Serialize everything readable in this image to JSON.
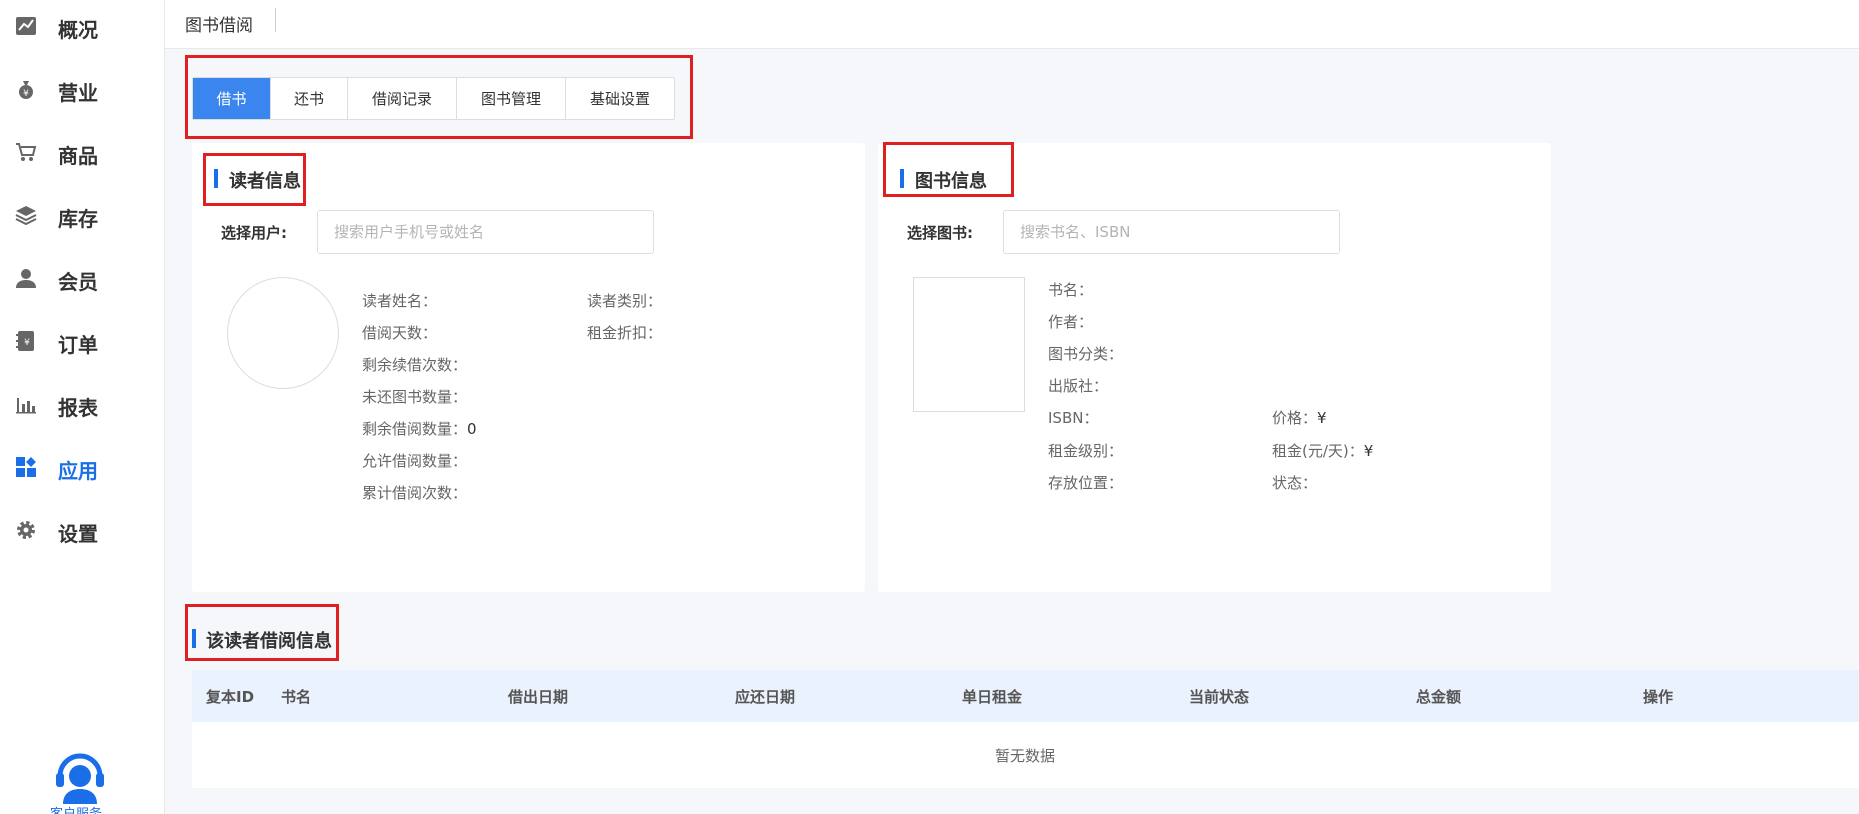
{
  "sidebar": {
    "items": [
      {
        "label": "概况",
        "icon": "trend-chart-icon"
      },
      {
        "label": "营业",
        "icon": "money-bag-icon"
      },
      {
        "label": "商品",
        "icon": "cart-icon"
      },
      {
        "label": "库存",
        "icon": "layers-icon"
      },
      {
        "label": "会员",
        "icon": "user-icon"
      },
      {
        "label": "订单",
        "icon": "order-book-icon"
      },
      {
        "label": "报表",
        "icon": "bar-chart-icon"
      },
      {
        "label": "应用",
        "icon": "apps-icon",
        "active": true
      },
      {
        "label": "设置",
        "icon": "gear-icon"
      }
    ],
    "service_label": "客户服务"
  },
  "header": {
    "title": "图书借阅"
  },
  "tabs": [
    {
      "label": "借书",
      "active": true
    },
    {
      "label": "还书"
    },
    {
      "label": "借阅记录"
    },
    {
      "label": "图书管理"
    },
    {
      "label": "基础设置"
    }
  ],
  "reader": {
    "title": "读者信息",
    "select_label": "选择用户:",
    "search_placeholder": "搜索用户手机号或姓名",
    "fields": {
      "name": "读者姓名：",
      "category": "读者类别：",
      "days": "借阅天数：",
      "discount": "租金折扣：",
      "renew": "剩余续借次数：",
      "unreturned": "未还图书数量：",
      "remaining": "剩余借阅数量：",
      "remaining_value": "0",
      "allowed": "允许借阅数量：",
      "total": "累计借阅次数："
    }
  },
  "book": {
    "title": "图书信息",
    "select_label": "选择图书:",
    "search_placeholder": "搜索书名、ISBN",
    "fields": {
      "name": "书名：",
      "author": "作者：",
      "category": "图书分类：",
      "publisher": "出版社：",
      "isbn": "ISBN：",
      "price": "价格：",
      "price_value": "¥",
      "rent_level": "租金级别：",
      "rent": "租金(元/天)：",
      "rent_value": "¥",
      "location": "存放位置：",
      "status": "状态："
    }
  },
  "borrow": {
    "title": "该读者借阅信息",
    "columns": [
      "复本ID",
      "书名",
      "借出日期",
      "应还日期",
      "单日租金",
      "当前状态",
      "总金额",
      "操作"
    ],
    "empty_text": "暂无数据"
  },
  "colors": {
    "accent": "#1a6ee8",
    "tab_active": "#3a85ee",
    "highlight_box": "#e02020",
    "table_header": "#eaf2fd"
  }
}
